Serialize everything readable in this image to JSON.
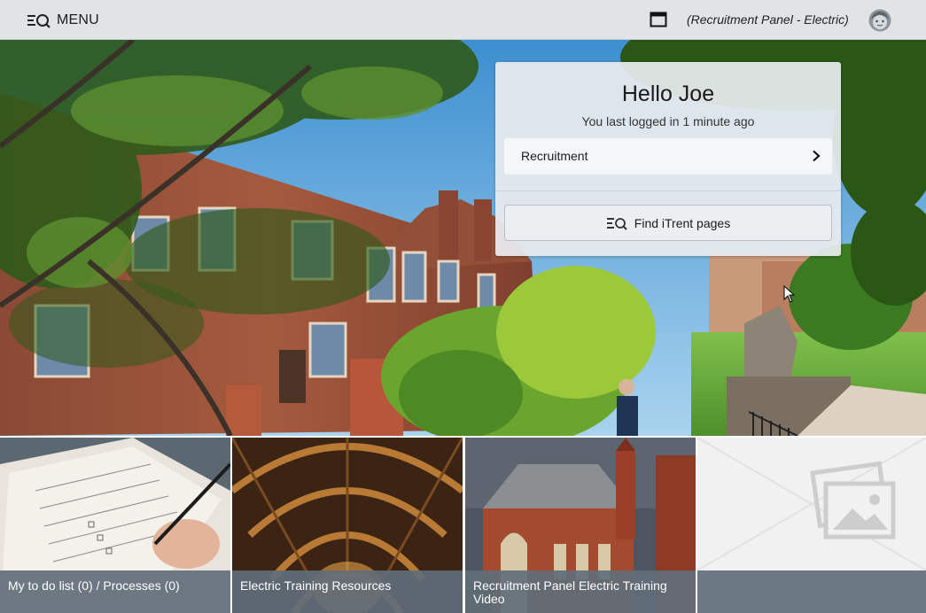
{
  "topbar": {
    "menu_icon": "menu-search-icon",
    "menu_label": "MENU",
    "window_icon": "window-icon",
    "role": "(Recruitment Panel - Electric)",
    "avatar_icon": "user-avatar-icon"
  },
  "welcome": {
    "greeting": "Hello Joe",
    "last_login": "You last logged in 1 minute ago",
    "quick_link": {
      "label": "Recruitment",
      "icon": "chevron-right-icon"
    },
    "find_button": {
      "label": "Find iTrent pages",
      "icon": "menu-search-icon"
    }
  },
  "tiles": [
    {
      "caption": "My to do list (0) / Processes (0)",
      "image": "notebook-checklist-photo"
    },
    {
      "caption": "Electric Training Resources",
      "image": "vaulted-hall-ceiling-photo"
    },
    {
      "caption": "Recruitment Panel Electric Training Video",
      "image": "red-brick-chapel-photo"
    },
    {
      "caption": "",
      "image": "image-placeholder-icon"
    }
  ],
  "colors": {
    "topbar": "#e1e4e7",
    "caption_bg": "#616e7a",
    "card_bg": "#e8ecef"
  }
}
